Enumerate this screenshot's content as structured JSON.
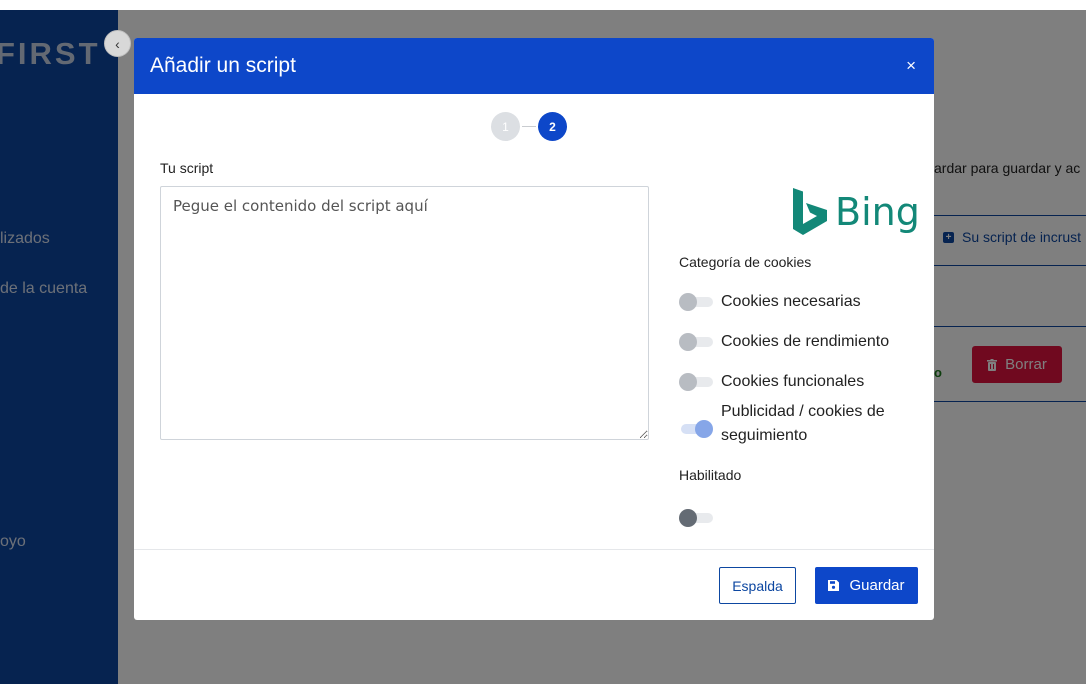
{
  "background": {
    "logo": "FIRST",
    "sidebar_links": [
      "lizados",
      "de la cuenta",
      "oyo"
    ],
    "instructions_text": "ardar para guardar y ac",
    "embed_link": "Su script de incrust",
    "delete_label": "Borrar",
    "status_partial": "o"
  },
  "modal": {
    "title": "Añadir un script",
    "close": "×",
    "steps": [
      "1",
      "2"
    ],
    "active_step": 2,
    "script_label": "Tu script",
    "script_placeholder": "Pegue el contenido del script aquí",
    "brand_logo": "Bing",
    "cookie_category_label": "Categoría de cookies",
    "cookie_options": [
      {
        "label": "Cookies necesarias",
        "on": false
      },
      {
        "label": "Cookies de rendimiento",
        "on": false
      },
      {
        "label": "Cookies funcionales",
        "on": false
      },
      {
        "label": "Publicidad / cookies de seguimiento",
        "on": true
      }
    ],
    "enabled_label": "Habilitado",
    "enabled": false,
    "back_label": "Espalda",
    "save_label": "Guardar"
  },
  "colors": {
    "primary": "#0d47c9",
    "sidebar": "#0d47a1",
    "danger": "#e0123e",
    "bing": "#138878"
  },
  "icons": [
    "chevron-left-icon",
    "close-icon",
    "plus-square-icon",
    "trash-icon",
    "save-icon",
    "bing-icon"
  ]
}
